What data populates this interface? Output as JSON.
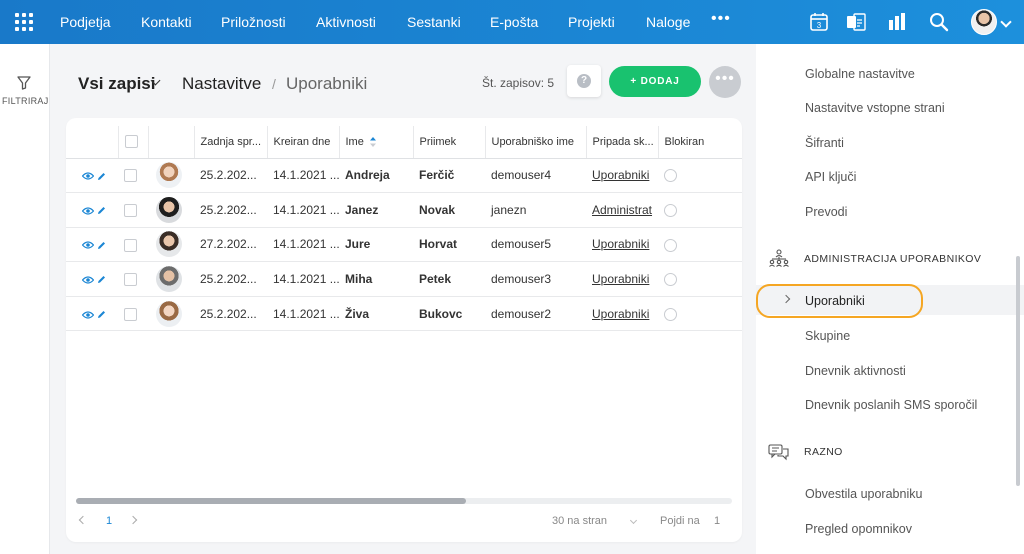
{
  "topbar": {
    "nav": [
      "Podjetja",
      "Kontakti",
      "Priložnosti",
      "Aktivnosti",
      "Sestanki",
      "E-pošta",
      "Projekti",
      "Naloge"
    ],
    "more": "•••",
    "calendar_day": "3"
  },
  "filter": {
    "label": "FILTRIRAJ"
  },
  "header": {
    "view": "Vsi zapisi",
    "breadcrumb_parent": "Nastavitve",
    "breadcrumb_sep": "/",
    "breadcrumb_current": "Uporabniki",
    "record_count": "Št. zapisov: 5",
    "help": "?",
    "add_label": "+ DODAJ",
    "more": "•••"
  },
  "table": {
    "columns": [
      "Zadnja spr...",
      "Kreiran dne",
      "Ime",
      "Priimek",
      "Uporabniško ime",
      "Pripada sk...",
      "Blokiran"
    ],
    "rows": [
      {
        "modified": "25.2.202...",
        "created": "14.1.2021 ...",
        "first": "Andreja",
        "last": "Ferčič",
        "username": "demouser4",
        "group": "Uporabniki"
      },
      {
        "modified": "25.2.202...",
        "created": "14.1.2021 ...",
        "first": "Janez",
        "last": "Novak",
        "username": "janezn",
        "group": "Administrat"
      },
      {
        "modified": "27.2.202...",
        "created": "14.1.2021 ...",
        "first": "Jure",
        "last": "Horvat",
        "username": "demouser5",
        "group": "Uporabniki"
      },
      {
        "modified": "25.2.202...",
        "created": "14.1.2021 ...",
        "first": "Miha",
        "last": "Petek",
        "username": "demouser3",
        "group": "Uporabniki"
      },
      {
        "modified": "25.2.202...",
        "created": "14.1.2021 ...",
        "first": "Živa",
        "last": "Bukovc",
        "username": "demouser2",
        "group": "Uporabniki"
      }
    ]
  },
  "pager": {
    "page": "1",
    "page_size": "30 na stran",
    "goto_label": "Pojdi na",
    "goto_value": "1"
  },
  "settings": {
    "items_top": [
      "Globalne nastavitve",
      "Nastavitve vstopne strani",
      "Šifranti",
      "API ključi",
      "Prevodi"
    ],
    "section_admin": "ADMINISTRACIJA UPORABNIKOV",
    "active_item": "Uporabniki",
    "items_admin": [
      "Skupine",
      "Dnevnik aktivnosti",
      "Dnevnik poslanih SMS sporočil"
    ],
    "section_misc": "RAZNO",
    "items_misc": [
      "Obvestila uporabniku",
      "Pregled opomnikov"
    ]
  },
  "colors": {
    "topbar": "#1b86d4",
    "add_button": "#19c26f",
    "highlight": "#f5a623",
    "eye_icon": "#1b86d4"
  }
}
